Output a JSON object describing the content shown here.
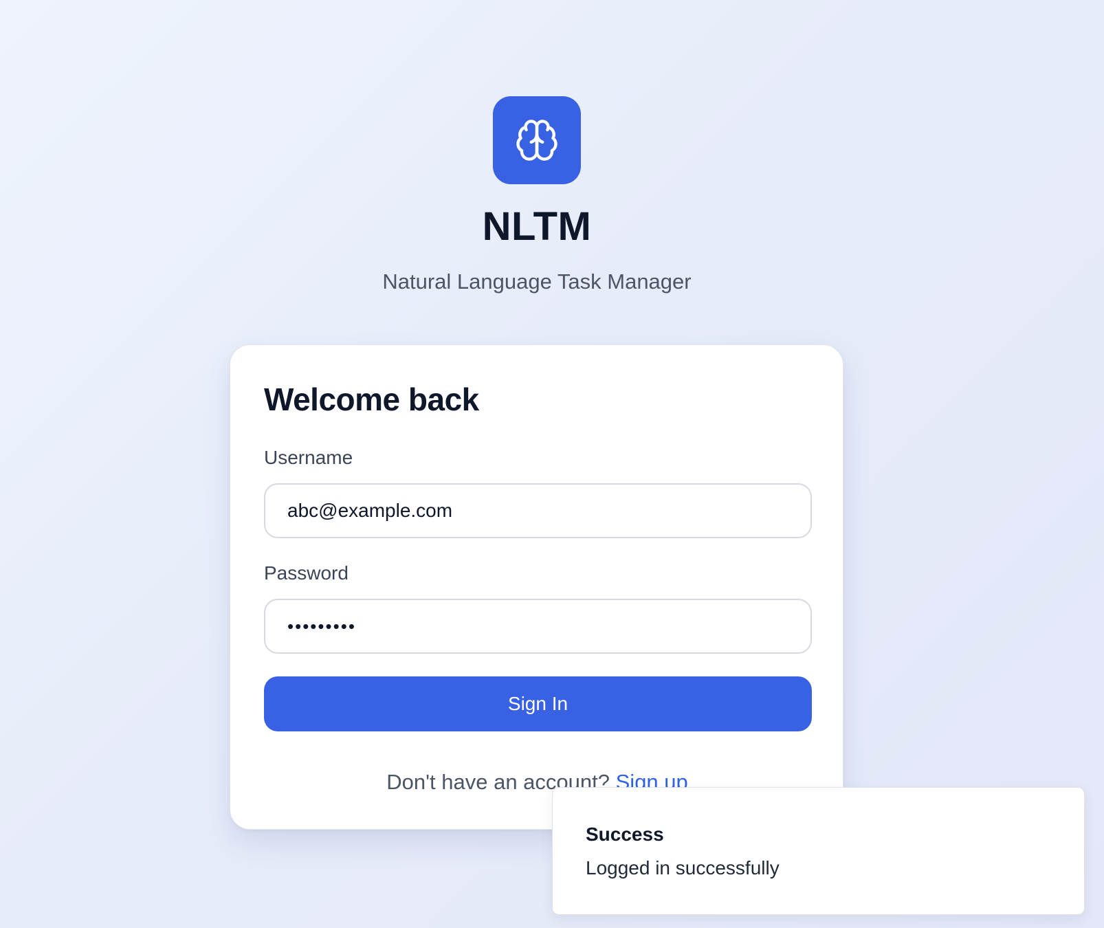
{
  "brand": {
    "logo_icon": "brain-icon",
    "name": "NLTM",
    "tagline": "Natural Language Task Manager",
    "accent_color": "#3862e3"
  },
  "login_form": {
    "title": "Welcome back",
    "username_label": "Username",
    "username_value": "abc@example.com",
    "password_label": "Password",
    "password_value_masked": "•••••••••",
    "submit_label": "Sign In",
    "signup_prompt": "Don't have an account?",
    "signup_link": "Sign up"
  },
  "toast": {
    "title": "Success",
    "message": "Logged in successfully"
  }
}
